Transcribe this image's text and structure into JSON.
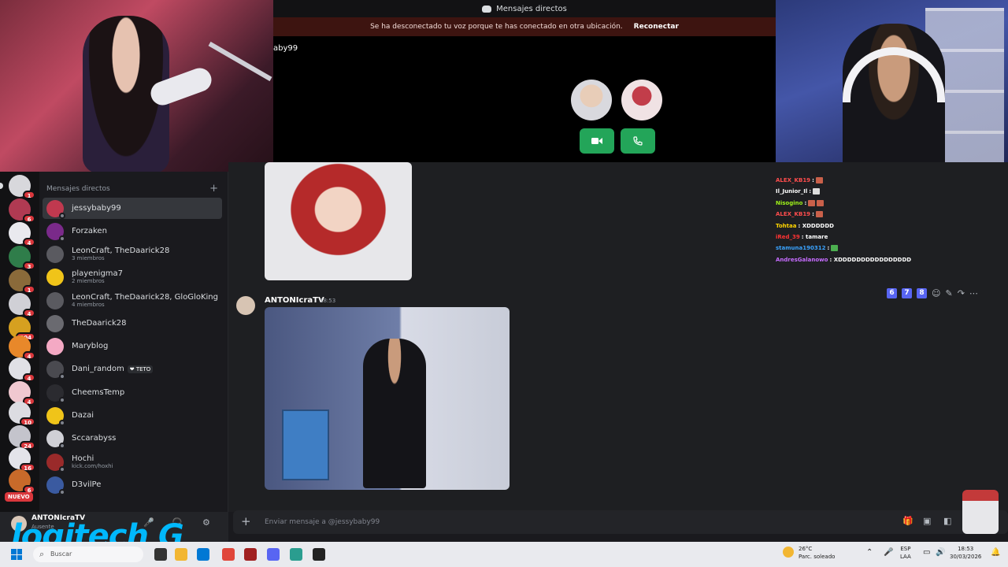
{
  "titlebar": {
    "title": "Mensajes directos"
  },
  "banner": {
    "message": "Se ha desconectado tu voz porque te has conectado en otra ubicación.",
    "action": "Reconectar"
  },
  "call": {
    "name": "aby99"
  },
  "rail": {
    "badges": [
      "1",
      "6",
      "4",
      "3",
      "1",
      "4",
      "304",
      "4",
      "4",
      "4",
      "10",
      "24",
      "16",
      "6"
    ],
    "new_label": "NUEVO"
  },
  "sidebar": {
    "header": "Mensajes directos",
    "add_icon": "plus-icon",
    "items": [
      {
        "name": "jessybaby99",
        "sub": ""
      },
      {
        "name": "Forzaken",
        "sub": ""
      },
      {
        "name": "LeonCraft, TheDaarick28",
        "sub": "3 miembros"
      },
      {
        "name": "playenigma7",
        "sub": "2 miembros"
      },
      {
        "name": "LeonCraft, TheDaarick28, GloGloKing",
        "sub": "4 miembros"
      },
      {
        "name": "TheDaarick28",
        "sub": ""
      },
      {
        "name": "Maryblog",
        "sub": ""
      },
      {
        "name": "Dani_random",
        "sub": "",
        "tag": "❤ TETO"
      },
      {
        "name": "CheemsTemp",
        "sub": ""
      },
      {
        "name": "Dazai",
        "sub": ""
      },
      {
        "name": "Sccarabyss",
        "sub": ""
      },
      {
        "name": "Hochi",
        "sub": "kick.com/hoxhi"
      },
      {
        "name": "D3vilPe",
        "sub": ""
      }
    ]
  },
  "user": {
    "name": "ANTONIcraTV",
    "status": "Ausente"
  },
  "brand": {
    "logo_text": "logitech G"
  },
  "message": {
    "author": "ANTONIcraTV",
    "time": "18:53"
  },
  "message_tools": {
    "nums": [
      "6",
      "7",
      "8"
    ]
  },
  "stream_chat": [
    {
      "user": "ALEX_KB19",
      "sep": ":",
      "text": "",
      "color": "#ff4d4d"
    },
    {
      "user": "Il_Junior_Il",
      "sep": ":",
      "text": "",
      "color": "#ffffff"
    },
    {
      "user": "Nisogino",
      "sep": ":",
      "text": "",
      "color": "#9ef01a"
    },
    {
      "user": "ALEX_KB19",
      "sep": ":",
      "text": "",
      "color": "#ff4d4d"
    },
    {
      "user": "Tohtaa",
      "sep": ":",
      "text": "XDDDDDD",
      "color": "#ffd400"
    },
    {
      "user": "iRed_39",
      "sep": ":",
      "text": "tamare",
      "color": "#ff3333"
    },
    {
      "user": "stamuna190312",
      "sep": ":",
      "text": "",
      "color": "#3aa3ff"
    },
    {
      "user": "AndresGalanowo",
      "sep": ":",
      "text": "XDDDDDDDDDDDDDDDD",
      "color": "#c66cff"
    }
  ],
  "composer": {
    "placeholder": "Enviar mensaje a @jessybaby99"
  },
  "taskbar": {
    "search": "Buscar",
    "weather_temp": "26°C",
    "weather_desc": "Parc. soleado",
    "lang1": "ESP",
    "lang2": "LAA",
    "time": "18:53",
    "date": "30/03/2026"
  }
}
